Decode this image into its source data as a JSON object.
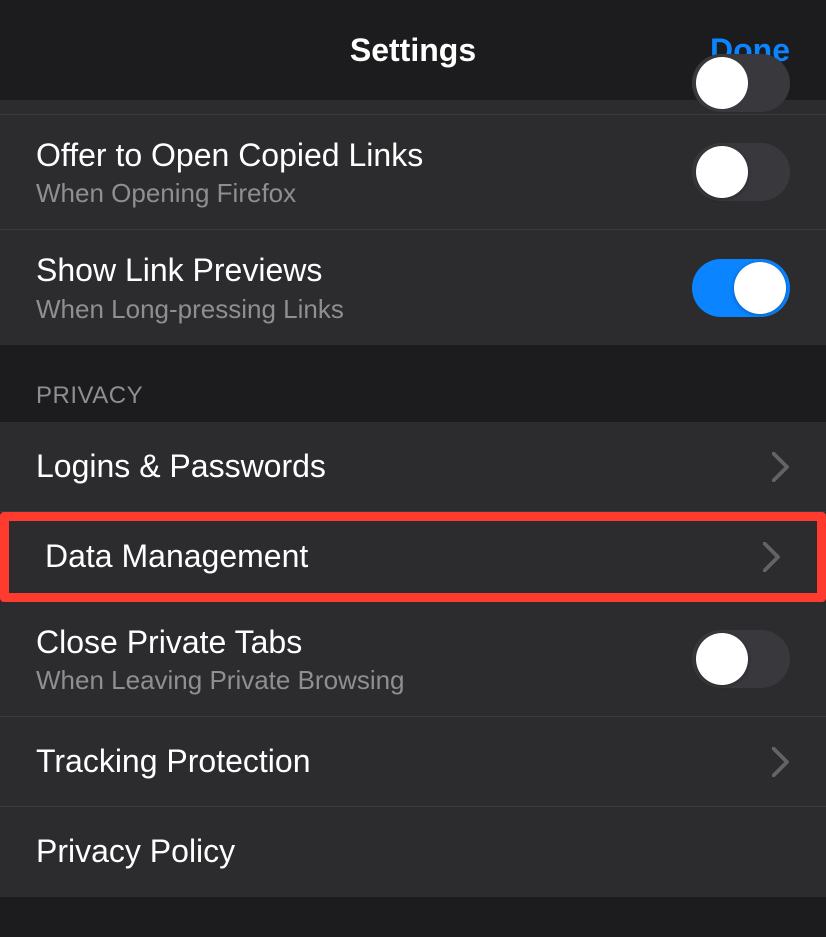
{
  "header": {
    "title": "Settings",
    "done_label": "Done"
  },
  "section1": {
    "offer_copied_links": {
      "title": "Offer to Open Copied Links",
      "subtitle": "When Opening Firefox",
      "toggle_on": false
    },
    "show_link_previews": {
      "title": "Show Link Previews",
      "subtitle": "When Long-pressing Links",
      "toggle_on": true
    }
  },
  "section2": {
    "header": "PRIVACY",
    "logins_passwords": {
      "title": "Logins & Passwords"
    },
    "data_management": {
      "title": "Data Management"
    },
    "close_private_tabs": {
      "title": "Close Private Tabs",
      "subtitle": "When Leaving Private Browsing",
      "toggle_on": false
    },
    "tracking_protection": {
      "title": "Tracking Protection"
    },
    "privacy_policy": {
      "title": "Privacy Policy"
    }
  }
}
